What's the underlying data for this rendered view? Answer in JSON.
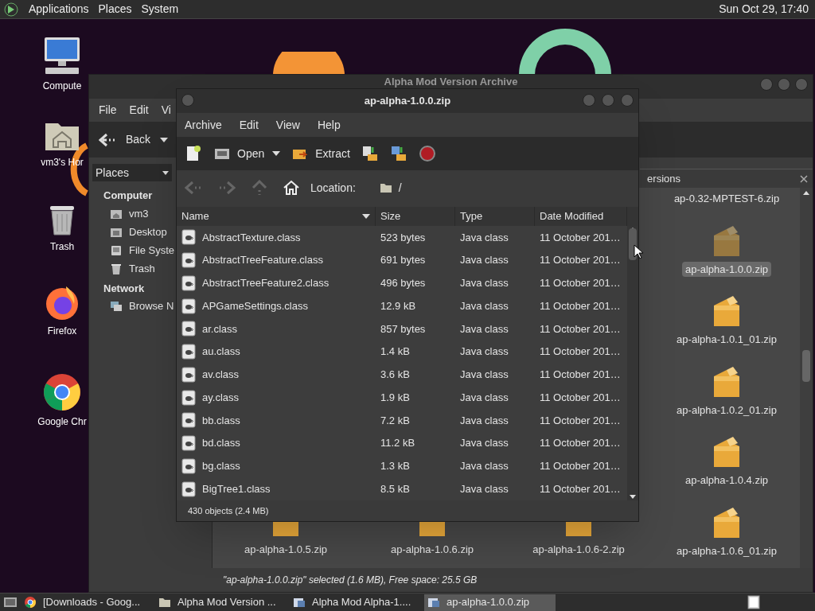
{
  "top_panel": {
    "menus": [
      "Applications",
      "Places",
      "System"
    ],
    "clock": "Sun Oct 29, 17:40"
  },
  "desktop_icons": [
    {
      "kind": "computer",
      "label": "Compute"
    },
    {
      "kind": "home",
      "label": "vm3's Hor"
    },
    {
      "kind": "trash",
      "label": "Trash"
    },
    {
      "kind": "firefox",
      "label": "Firefox"
    },
    {
      "kind": "chrome",
      "label": "Google Chr"
    }
  ],
  "file_manager": {
    "title": "Alpha Mod Version Archive",
    "menus": [
      "File",
      "Edit",
      "Vi"
    ],
    "back": "Back",
    "places_dropdown": "Places",
    "sidebar": [
      {
        "heading": "Computer",
        "items": [
          {
            "kind": "home",
            "label": "vm3"
          },
          {
            "kind": "desktop",
            "label": "Desktop"
          },
          {
            "kind": "drive",
            "label": "File Syste"
          },
          {
            "kind": "trash",
            "label": "Trash"
          }
        ]
      },
      {
        "heading": "Network",
        "items": [
          {
            "kind": "network",
            "label": "Browse N"
          }
        ]
      }
    ],
    "tab": "ersions",
    "right_column": [
      {
        "kind": "name_only",
        "label": "ap-0.32-MPTEST-6.zip",
        "selected": false
      },
      {
        "kind": "archive",
        "label": "ap-alpha-1.0.0.zip",
        "selected": true
      },
      {
        "kind": "archive",
        "label": "ap-alpha-1.0.1_01.zip",
        "selected": false
      },
      {
        "kind": "archive",
        "label": "ap-alpha-1.0.2_01.zip",
        "selected": false
      },
      {
        "kind": "archive",
        "label": "ap-alpha-1.0.4.zip",
        "selected": false
      },
      {
        "kind": "archive",
        "label": "ap-alpha-1.0.6_01.zip",
        "selected": false
      }
    ],
    "bottom_row": [
      {
        "kind": "archive",
        "label": "ap-alpha-1.0.5.zip",
        "selected": false
      },
      {
        "kind": "archive",
        "label": "ap-alpha-1.0.6.zip",
        "selected": false
      },
      {
        "kind": "archive",
        "label": "ap-alpha-1.0.6-2.zip",
        "selected": false
      }
    ],
    "status": "\"ap-alpha-1.0.0.zip\" selected (1.6 MB), Free space: 25.5 GB"
  },
  "archive_manager": {
    "title": "ap-alpha-1.0.0.zip",
    "menus": [
      "Archive",
      "Edit",
      "View",
      "Help"
    ],
    "toolbar": [
      {
        "kind": "new"
      },
      {
        "kind": "open",
        "label": "Open"
      },
      {
        "kind": "extract",
        "label": "Extract"
      },
      {
        "kind": "add_files"
      },
      {
        "kind": "add_folder"
      },
      {
        "kind": "stop"
      }
    ],
    "location_label": "Location:",
    "location": "/",
    "columns": [
      "Name",
      "Size",
      "Type",
      "Date Modified"
    ],
    "rows": [
      [
        "AbstractTexture.class",
        "523 bytes",
        "Java class",
        "11 October 201…"
      ],
      [
        "AbstractTreeFeature.class",
        "691 bytes",
        "Java class",
        "11 October 201…"
      ],
      [
        "AbstractTreeFeature2.class",
        "496 bytes",
        "Java class",
        "11 October 201…"
      ],
      [
        "APGameSettings.class",
        "12.9 kB",
        "Java class",
        "11 October 201…"
      ],
      [
        "ar.class",
        "857 bytes",
        "Java class",
        "11 October 201…"
      ],
      [
        "au.class",
        "1.4 kB",
        "Java class",
        "11 October 201…"
      ],
      [
        "av.class",
        "3.6 kB",
        "Java class",
        "11 October 201…"
      ],
      [
        "ay.class",
        "1.9 kB",
        "Java class",
        "11 October 201…"
      ],
      [
        "bb.class",
        "7.2 kB",
        "Java class",
        "11 October 201…"
      ],
      [
        "bd.class",
        "11.2 kB",
        "Java class",
        "11 October 201…"
      ],
      [
        "bg.class",
        "1.3 kB",
        "Java class",
        "11 October 201…"
      ],
      [
        "BigTree1.class",
        "8.5 kB",
        "Java class",
        "11 October 201…"
      ]
    ],
    "status": "430 objects (2.4 MB)"
  },
  "taskbar": [
    {
      "kind": "chrome",
      "label": "[Downloads - Goog...",
      "selected": false
    },
    {
      "kind": "folder",
      "label": "Alpha Mod Version ...",
      "selected": false
    },
    {
      "kind": "archive",
      "label": "Alpha Mod Alpha-1....",
      "selected": false
    },
    {
      "kind": "archive",
      "label": "ap-alpha-1.0.0.zip",
      "selected": true
    }
  ]
}
